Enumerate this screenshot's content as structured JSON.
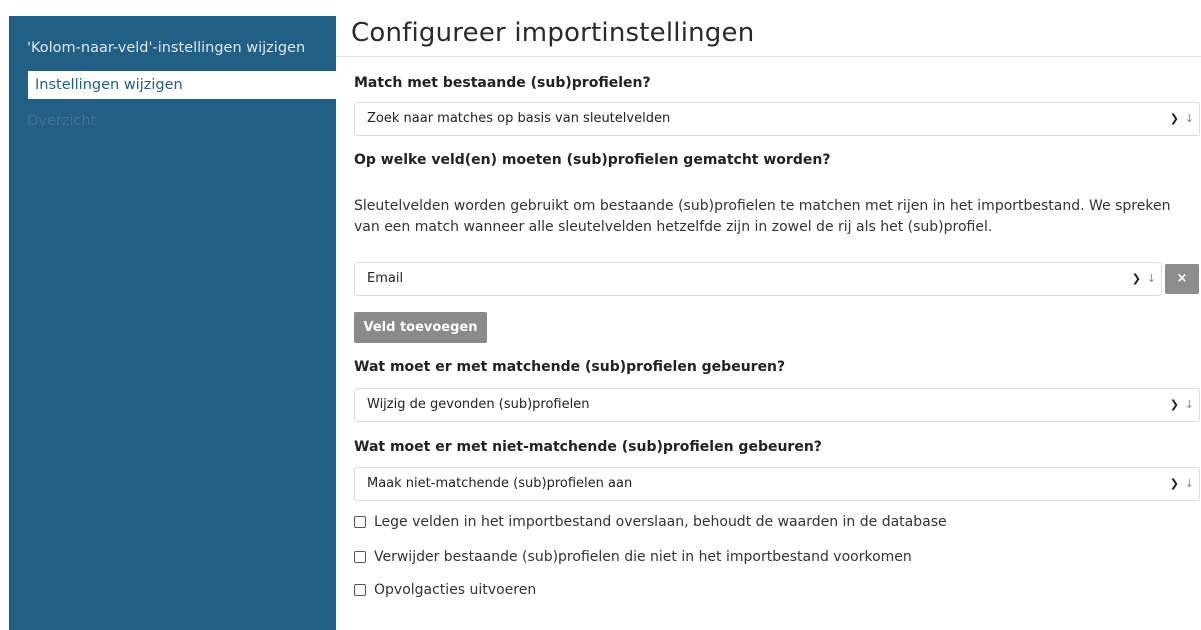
{
  "sidebar": {
    "items": [
      {
        "label": "'Kolom-naar-veld'-instellingen wijzigen"
      },
      {
        "label": "Instellingen wijzigen"
      },
      {
        "label": "Overzicht"
      }
    ]
  },
  "main": {
    "title": "Configureer importinstellingen",
    "match_question": "Match met bestaande (sub)profielen?",
    "match_select": "Zoek naar matches op basis van sleutelvelden",
    "fields_question": "Op welke veld(en) moeten (sub)profielen gematcht worden?",
    "fields_description": "Sleutelvelden worden gebruikt om bestaande (sub)profielen te matchen met rijen in het importbestand. We spreken van een match wanneer alle sleutelvelden hetzelfde zijn in zowel de rij als het (sub)profiel.",
    "key_field_select": "Email",
    "remove_label": "×",
    "add_field_label": "Veld toevoegen",
    "matching_question": "Wat moet er met matchende (sub)profielen gebeuren?",
    "matching_select": "Wijzig de gevonden (sub)profielen",
    "nonmatching_question": "Wat moet er met niet-matchende (sub)profielen gebeuren?",
    "nonmatching_select": "Maak niet-matchende (sub)profielen aan",
    "checkboxes": [
      {
        "label": "Lege velden in het importbestand overslaan, behoudt de waarden in de database",
        "checked": false
      },
      {
        "label": "Verwijder bestaande (sub)profielen die niet in het importbestand voorkomen",
        "checked": false
      },
      {
        "label": "Opvolgacties uitvoeren",
        "checked": false
      }
    ]
  },
  "icons": {
    "select_chevron": "chevron-down-icon",
    "select_double_chevron": "double-chevron-icon",
    "remove": "close-icon"
  },
  "colors": {
    "sidebar_bg": "#225f84",
    "sidebar_active_text": "#225f84",
    "button_bg": "#8a8a8a"
  }
}
